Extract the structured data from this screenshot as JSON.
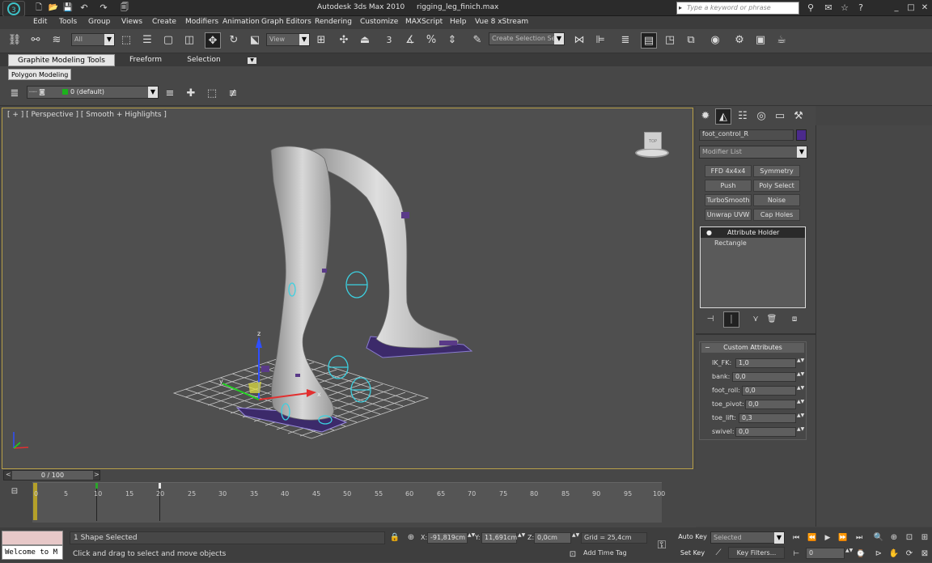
{
  "titlebar": {
    "app_title": "Autodesk 3ds Max  2010",
    "file_name": "rigging_leg_finich.max",
    "search_placeholder": "Type a keyword or phrase",
    "minimize": "_",
    "maximize": "□",
    "close": "✕"
  },
  "menu": [
    "Edit",
    "Tools",
    "Group",
    "Views",
    "Create",
    "Modifiers",
    "Animation",
    "Graph Editors",
    "Rendering",
    "Customize",
    "MAXScript",
    "Help",
    "Vue 8 xStream"
  ],
  "toolbar": {
    "selection_filter": "All",
    "ref_coord": "View",
    "snap_num": "3",
    "named_selection_placeholder": "Create Selection Se"
  },
  "ribbon": {
    "tabs": [
      "Graphite Modeling Tools",
      "Freeform",
      "Selection"
    ],
    "sub_tab": "Polygon Modeling"
  },
  "layer": {
    "current": "0 (default)"
  },
  "viewport": {
    "label": "[ + ] [ Perspective ] [ Smooth + Highlights ]",
    "viewcube_label": "TOP"
  },
  "command_panel": {
    "object_name": "foot_control_R",
    "object_color": "#4b2a8c",
    "modifier_list": "Modifier List",
    "modifier_buttons": [
      "FFD 4x4x4",
      "Symmetry",
      "Push",
      "Poly Select",
      "TurboSmooth",
      "Noise",
      "Unwrap UVW",
      "Cap Holes"
    ],
    "stack": {
      "selected": "Attribute Holder",
      "base": "Rectangle"
    },
    "rollout_title": "Custom Attributes",
    "rollout_toggle": "−",
    "attributes": [
      {
        "name": "IK_FK:",
        "value": "1,0"
      },
      {
        "name": "bank:",
        "value": "0,0"
      },
      {
        "name": "foot_roll:",
        "value": "0,0"
      },
      {
        "name": "toe_pivot:",
        "value": "0,0"
      },
      {
        "name": "toe_lift:",
        "value": "0,3"
      },
      {
        "name": "swivel:",
        "value": "0,0"
      }
    ]
  },
  "timeline": {
    "slider": "0 / 100",
    "prev": "<",
    "next": ">",
    "ticks": [
      "0",
      "5",
      "10",
      "15",
      "20",
      "25",
      "30",
      "35",
      "40",
      "45",
      "50",
      "55",
      "60",
      "65",
      "70",
      "75",
      "80",
      "85",
      "90",
      "95",
      "100"
    ]
  },
  "status": {
    "listener": "Welcome to M",
    "selection": "1 Shape Selected",
    "prompt": "Click and drag to select and move objects",
    "x_label": "X:",
    "x": "-91,819cm",
    "y_label": "Y:",
    "y": "11,691cm",
    "z_label": "Z:",
    "z": "0,0cm",
    "grid": "Grid = 25,4cm",
    "add_time_tag": "Add Time Tag",
    "auto_key": "Auto Key",
    "set_key": "Set Key",
    "key_mode": "Selected",
    "key_filters": "Key Filters...",
    "frame": "0"
  }
}
